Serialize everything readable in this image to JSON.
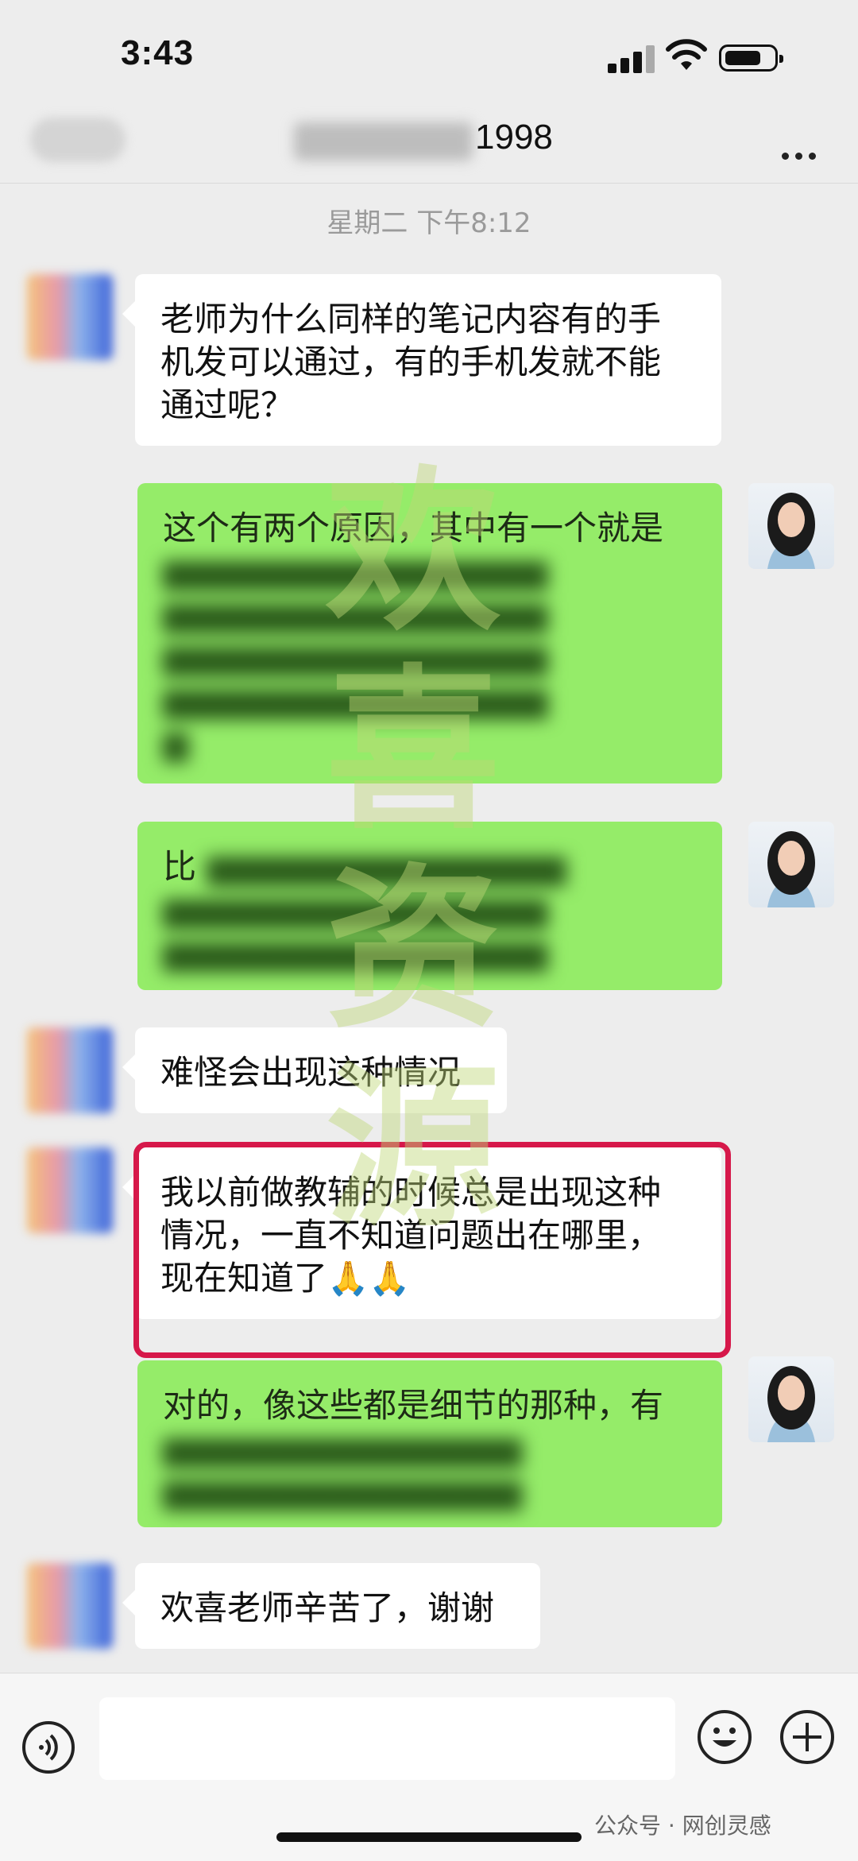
{
  "status_bar": {
    "time": "3:43"
  },
  "header": {
    "title_suffix": "1998",
    "more_icon": "more-dots-icon",
    "back_icon": "back-chevron-icon"
  },
  "chat": {
    "timestamp": "星期二 下午8:12",
    "messages": [
      {
        "side": "left",
        "text": "老师为什么同样的笔记内容有的手\n机发可以通过，有的手机发就不能\n通过呢？"
      },
      {
        "side": "right",
        "visible_text": "这个有两个原因，其中有一个就是",
        "blurred": true
      },
      {
        "side": "right",
        "visible_text": "比",
        "blurred": true
      },
      {
        "side": "left",
        "text": "难怪会出现这种情况"
      },
      {
        "side": "left",
        "text": "我以前做教辅的时候总是出现这种\n情况，一直不知道问题出在哪里，\n现在知道了🙏🙏",
        "highlighted": true
      },
      {
        "side": "right",
        "visible_text": "对的，像这些都是细节的那种，有",
        "blurred": true
      },
      {
        "side": "left",
        "text": "欢喜老师辛苦了，谢谢"
      }
    ]
  },
  "watermark": {
    "text": "欢喜资源"
  },
  "input_bar": {
    "voice_icon": "voice-icon",
    "emoji_icon": "emoji-icon",
    "add_icon": "plus-icon"
  },
  "footer_mark": {
    "text": "公众号 · 网创灵感"
  },
  "colors": {
    "background": "#ededed",
    "green_bubble": "#95ec69",
    "highlight_border": "#d6184a"
  }
}
